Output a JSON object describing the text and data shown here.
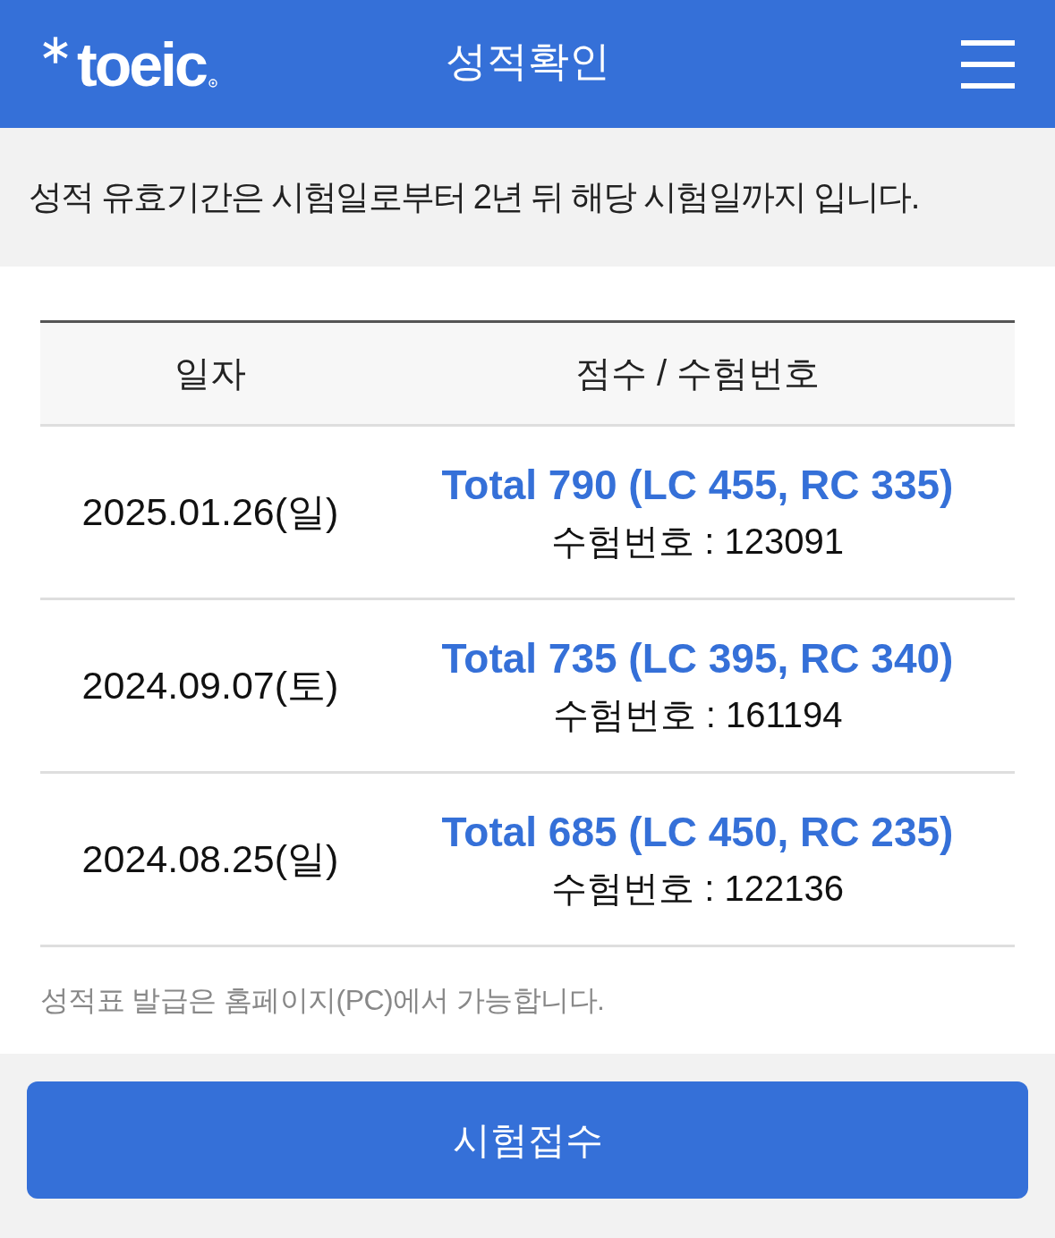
{
  "header": {
    "logo": "toeic",
    "title": "성적확인"
  },
  "notice": "성적 유효기간은 시험일로부터 2년 뒤 해당 시험일까지 입니다.",
  "table": {
    "columns": [
      "일자",
      "점수 / 수험번호"
    ],
    "rows": [
      {
        "date": "2025.01.26(일)",
        "score": "Total 790 (LC 455, RC 335)",
        "exam_number": "수험번호 : 123091"
      },
      {
        "date": "2024.09.07(토)",
        "score": "Total 735 (LC 395, RC 340)",
        "exam_number": "수험번호 : 161194"
      },
      {
        "date": "2024.08.25(일)",
        "score": "Total 685 (LC 450, RC 235)",
        "exam_number": "수험번호 : 122136"
      }
    ]
  },
  "footnote": "성적표 발급은 홈페이지(PC)에서 가능합니다.",
  "button": "시험접수"
}
